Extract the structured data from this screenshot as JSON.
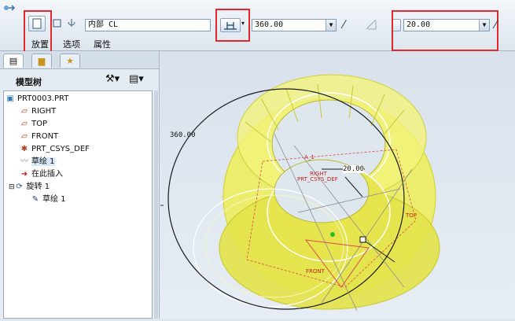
{
  "toolbar": {
    "tabs": [
      "放置",
      "选项",
      "属性"
    ],
    "axis_combo": "内部 CL",
    "angle_combo": "360.00",
    "second_angle_combo": "20.00"
  },
  "left_panel": {
    "title": "模型树",
    "tree": [
      {
        "label": "PRT0003.PRT",
        "icon": "part-icon"
      },
      {
        "label": "RIGHT",
        "icon": "datum-plane-icon"
      },
      {
        "label": "TOP",
        "icon": "datum-plane-icon"
      },
      {
        "label": "FRONT",
        "icon": "datum-plane-icon"
      },
      {
        "label": "PRT_CSYS_DEF",
        "icon": "csys-icon"
      },
      {
        "label": "草绘 1",
        "icon": "sketch-icon"
      },
      {
        "label": "在此插入",
        "icon": "insert-arrow-icon"
      },
      {
        "label": "旋转 1",
        "icon": "revolve-icon"
      },
      {
        "label": "草绘 1",
        "icon": "sketch-icon"
      }
    ]
  },
  "viewport": {
    "dim_angle": "360.00",
    "dim_angle2": "20.00",
    "labels": [
      "A_1",
      "RIGHT",
      "PRT_CSYS_DEF",
      "TOP",
      "FRONT"
    ]
  },
  "colors": {
    "highlight_box": "#e02a2a",
    "torus_fill": "#ecec5a",
    "background": "#dfe6ee"
  }
}
